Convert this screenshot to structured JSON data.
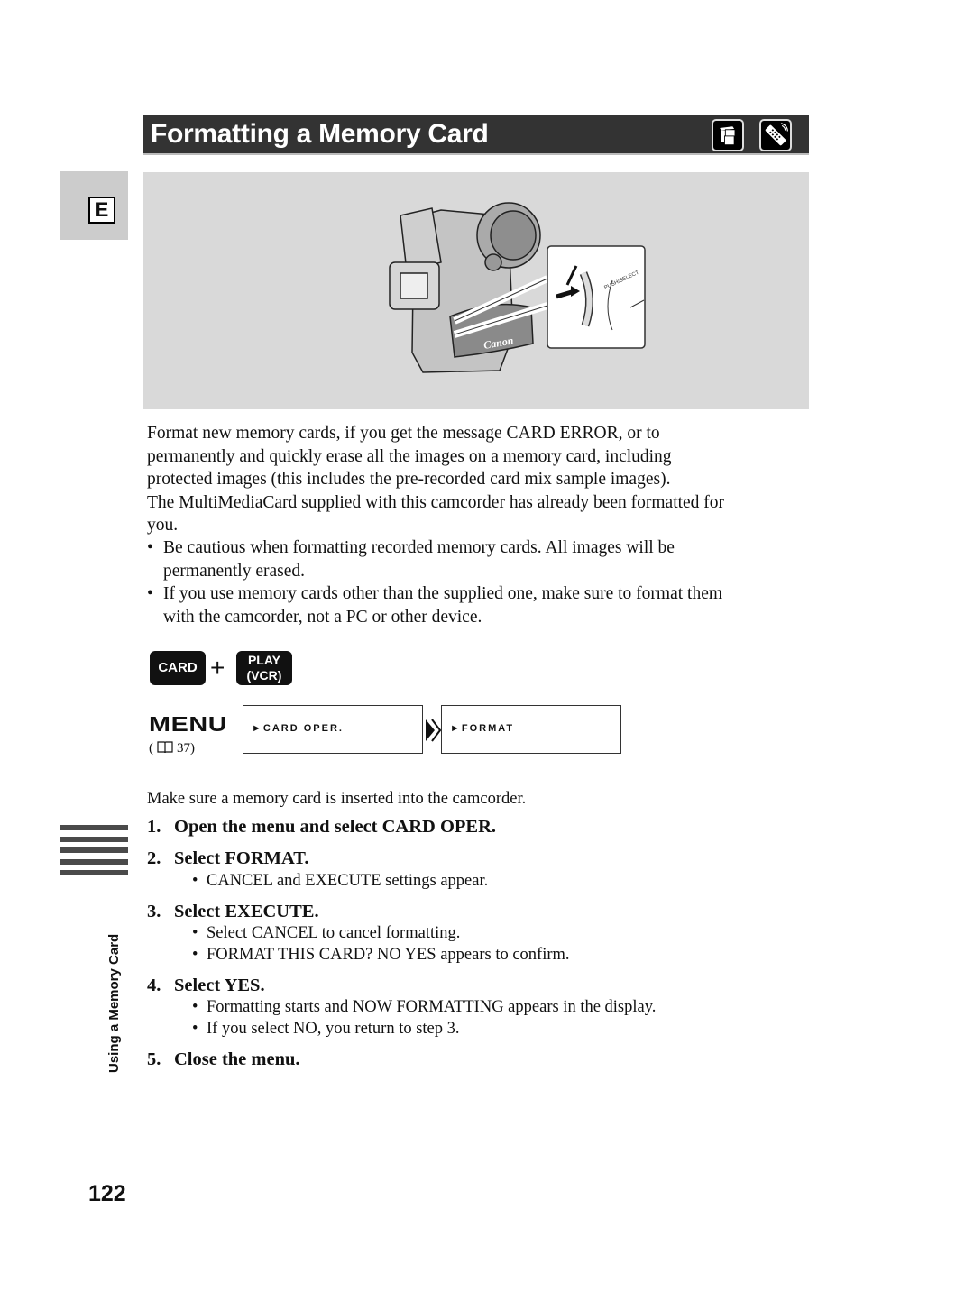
{
  "header": {
    "title": "Formatting a Memory Card",
    "icons": [
      "camcorder-icon",
      "remote-control-icon"
    ]
  },
  "language_tab": "E",
  "illustration": {
    "brand_label": "Canon",
    "dial_label": "PUSH/SELECT"
  },
  "intro": {
    "lines": [
      "Format new memory cards, if you get the message CARD ERROR, or to",
      "permanently and quickly erase all the images on a memory card, including",
      "protected images (this includes the pre-recorded card mix sample images).",
      "The MultiMediaCard supplied with this camcorder has already been formatted for",
      "you."
    ],
    "bullets": [
      {
        "line1": "Be cautious when formatting recorded memory cards. All images will be",
        "line2": "permanently erased."
      },
      {
        "line1": "If you use memory cards other than the supplied one, make sure to format them",
        "line2": "with the camcorder, not a PC or other device."
      }
    ]
  },
  "mode_keys": {
    "card": "CARD",
    "plus": "+",
    "play_line1": "PLAY",
    "play_line2": "(VCR)"
  },
  "menu": {
    "label": "MENU",
    "ref_open": "(",
    "ref_page": "37)",
    "path": [
      "►CARD OPER.",
      "►FORMAT"
    ]
  },
  "instructions": {
    "precondition": "Make sure a memory card is inserted into the camcorder.",
    "steps": [
      {
        "num": "1.",
        "text": "Open the menu and select CARD OPER.",
        "notes": []
      },
      {
        "num": "2.",
        "text": "Select FORMAT.",
        "notes": [
          "CANCEL and EXECUTE settings appear."
        ]
      },
      {
        "num": "3.",
        "text": "Select EXECUTE.",
        "notes": [
          "Select CANCEL to cancel formatting.",
          "FORMAT THIS CARD? NO YES appears to confirm."
        ]
      },
      {
        "num": "4.",
        "text": "Select YES.",
        "notes": [
          "Formatting starts and NOW FORMATTING appears in the display.",
          "If you select NO, you return to step 3."
        ]
      },
      {
        "num": "5.",
        "text": "Close the menu.",
        "notes": []
      }
    ]
  },
  "side_section_label": "Using a Memory Card",
  "page_number": "122",
  "bullet_char": "•"
}
